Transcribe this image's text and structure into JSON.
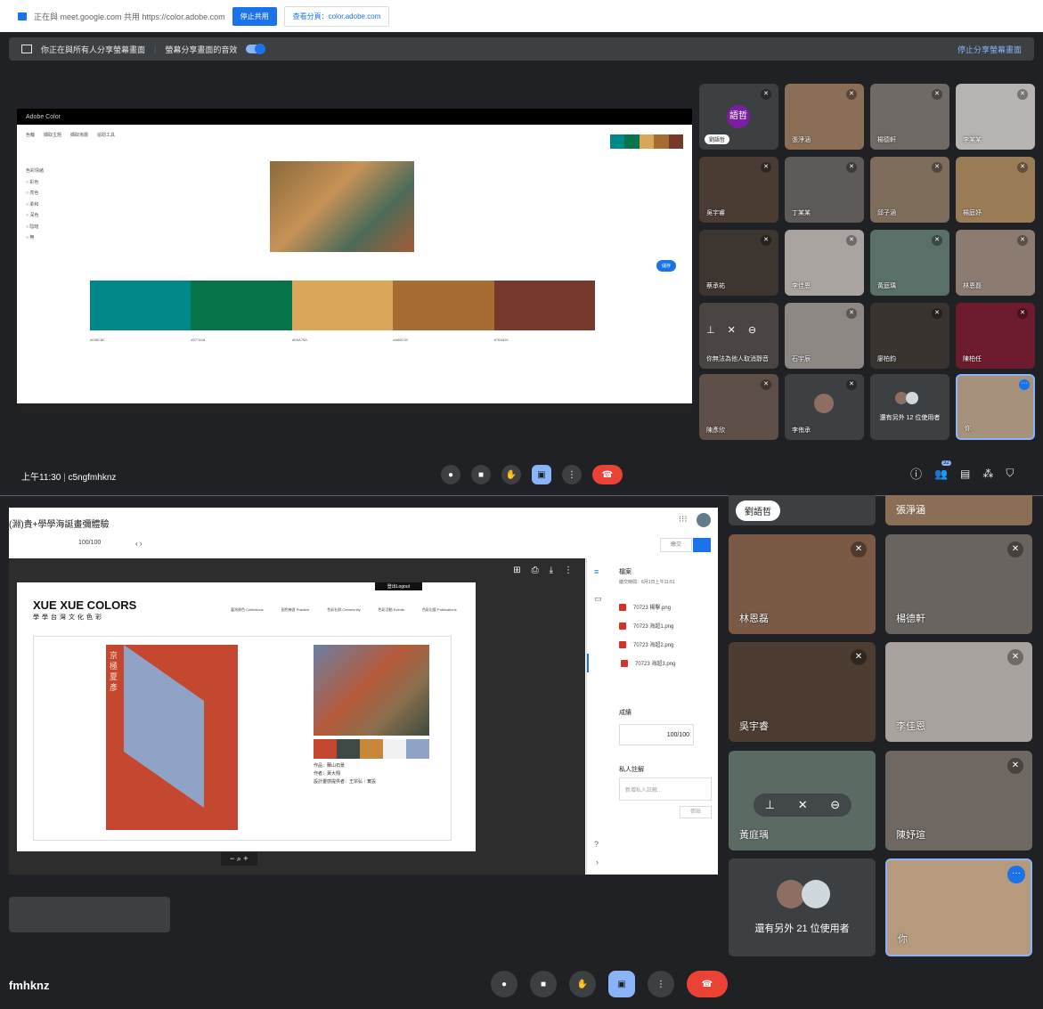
{
  "share_bar": {
    "text": "正在與 meet.google.com 共用 https://color.adobe.com",
    "stop_button": "停止共用",
    "switch_button": "查看分頁：color.adobe.com"
  },
  "banner": {
    "text": "你正在與所有人分享螢幕畫面",
    "audio_label": "螢幕分享畫面的音效",
    "stop_link": "停止分享螢幕畫面"
  },
  "adobe": {
    "app_title": "Adobe Color",
    "tabs": [
      "色輪",
      "擷取主題",
      "擷取漸層",
      "協助工具"
    ],
    "mood_title": "色彩情緒",
    "moods": [
      "彩色",
      "亮色",
      "柔和",
      "深色",
      "陰暗",
      "無"
    ],
    "swatch_colors": [
      "#00878a",
      "#07744a",
      "#d9a75a",
      "#a86c33",
      "#763a2c"
    ],
    "hex_codes": [
      "#048C8C",
      "#07744A",
      "#D9A75A",
      "#A86C33",
      "#763A2C"
    ],
    "save_button": "儲存"
  },
  "meet_top": {
    "time": "上午11:30",
    "meeting_code": "c5ngfmhknz",
    "participants_count": "32",
    "tiles": [
      {
        "name": "劉語哲",
        "initials": "語哲"
      },
      {
        "name": "張淨涵"
      },
      {
        "name": "楊德軒"
      },
      {
        "name": "李某某"
      },
      {
        "name": "吳宇睿"
      },
      {
        "name": "丁某某"
      },
      {
        "name": "邱子涵"
      },
      {
        "name": "楊庭妤"
      },
      {
        "name": "蔡承祐"
      },
      {
        "name": "李佳恩"
      },
      {
        "name": "黃庭瑀"
      },
      {
        "name": "林恩磊"
      },
      {
        "name": "你無法為他人取消靜音"
      },
      {
        "name": "石宇辰"
      },
      {
        "name": "廖柏鈞"
      },
      {
        "name": "陳柏任"
      },
      {
        "name": "陳彥欣"
      },
      {
        "name": "李侑承"
      },
      {
        "name": "還有另外 12 位使用者"
      },
      {
        "name": "你"
      }
    ]
  },
  "doc": {
    "breadcrumb": "(淵)貴+學學海誕畫彌體驗",
    "score": "100/100",
    "site_title_en": "XUE XUE COLORS",
    "site_subtitle": "學學台灣文化色彩",
    "logout": "登出Logout",
    "nav": [
      "臺灣原色 Collections",
      "配色練習 Practice",
      "色彩社群 Community",
      "色彩活動 Events",
      "色彩出版 Publications"
    ],
    "book_chars": "京極夏彥",
    "painting_palette": [
      "#c4472f",
      "#3f4a47",
      "#c8873a",
      "#f1f1f1",
      "#8fa3c6"
    ],
    "caption": [
      "作品：蘭山石景",
      "作者：黃大翔",
      "設計靈感提供者：王宗弘｜實設"
    ],
    "submit_button": "繳交",
    "files_title": "檔案",
    "files_meta": "繳交時間：6月1日上午11:51",
    "files": [
      "70723 楊擊.png",
      "70723 海超1.png",
      "70723 海超2.png",
      "70723 海超3.png"
    ],
    "grade_label": "成績",
    "grade_value": "100/100",
    "private_label": "私人註解",
    "private_placeholder": "新增私人註解...",
    "post_button": "張貼"
  },
  "meet_bottom": {
    "meeting_code_partial": "fmhknz",
    "tiles": [
      {
        "name": "劉語哲"
      },
      {
        "name": "張淨涵"
      },
      {
        "name": "林恩磊"
      },
      {
        "name": "楊德軒"
      },
      {
        "name": "吳宇睿"
      },
      {
        "name": "李佳恩"
      },
      {
        "name": "黃庭瑀"
      },
      {
        "name": "陳妤瑄"
      },
      {
        "name": "還有另外 21 位使用者"
      },
      {
        "name": "你"
      }
    ]
  }
}
